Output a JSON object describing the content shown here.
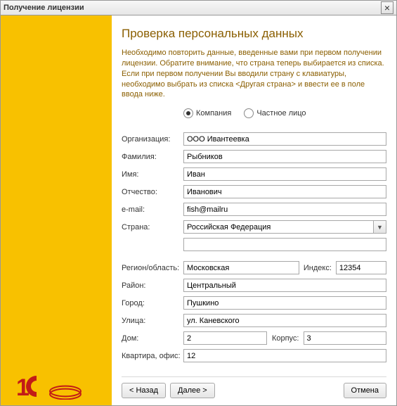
{
  "window": {
    "title": "Получение лицензии"
  },
  "main": {
    "heading": "Проверка персональных данных",
    "intro": "Необходимо повторить данные, введенные вами при первом получении лицензии. Обратите внимание, что страна теперь выбирается из списка. Если при первом получении Вы вводили страну с клавиатуры, необходимо выбрать из списка <Другая страна> и ввести ее в поле ввода ниже."
  },
  "entityType": {
    "company_label": "Компания",
    "individual_label": "Частное лицо",
    "selected": "company"
  },
  "fields": {
    "organization": {
      "label": "Организация:",
      "value": "ООО Ивантеевка"
    },
    "lastname": {
      "label": "Фамилия:",
      "value": "Рыбников"
    },
    "firstname": {
      "label": "Имя:",
      "value": "Иван"
    },
    "patronymic": {
      "label": "Отчество:",
      "value": "Иванович"
    },
    "email": {
      "label": "e-mail:",
      "value": "fish@mailru"
    },
    "country": {
      "label": "Страна:",
      "value": "Российская Федерация"
    },
    "country_other": {
      "value": ""
    },
    "region": {
      "label": "Регион/область:",
      "value": "Московская"
    },
    "index": {
      "label": "Индекс:",
      "value": "12354"
    },
    "district": {
      "label": "Район:",
      "value": "Центральный"
    },
    "city": {
      "label": "Город:",
      "value": "Пушкино"
    },
    "street": {
      "label": "Улица:",
      "value": "ул. Каневского"
    },
    "house": {
      "label": "Дом:",
      "value": "2"
    },
    "building": {
      "label": "Корпус:",
      "value": "3"
    },
    "apartment": {
      "label": "Квартира, офис:",
      "value": "12"
    }
  },
  "buttons": {
    "back": "< Назад",
    "next": "Далее >",
    "cancel": "Отмена"
  }
}
